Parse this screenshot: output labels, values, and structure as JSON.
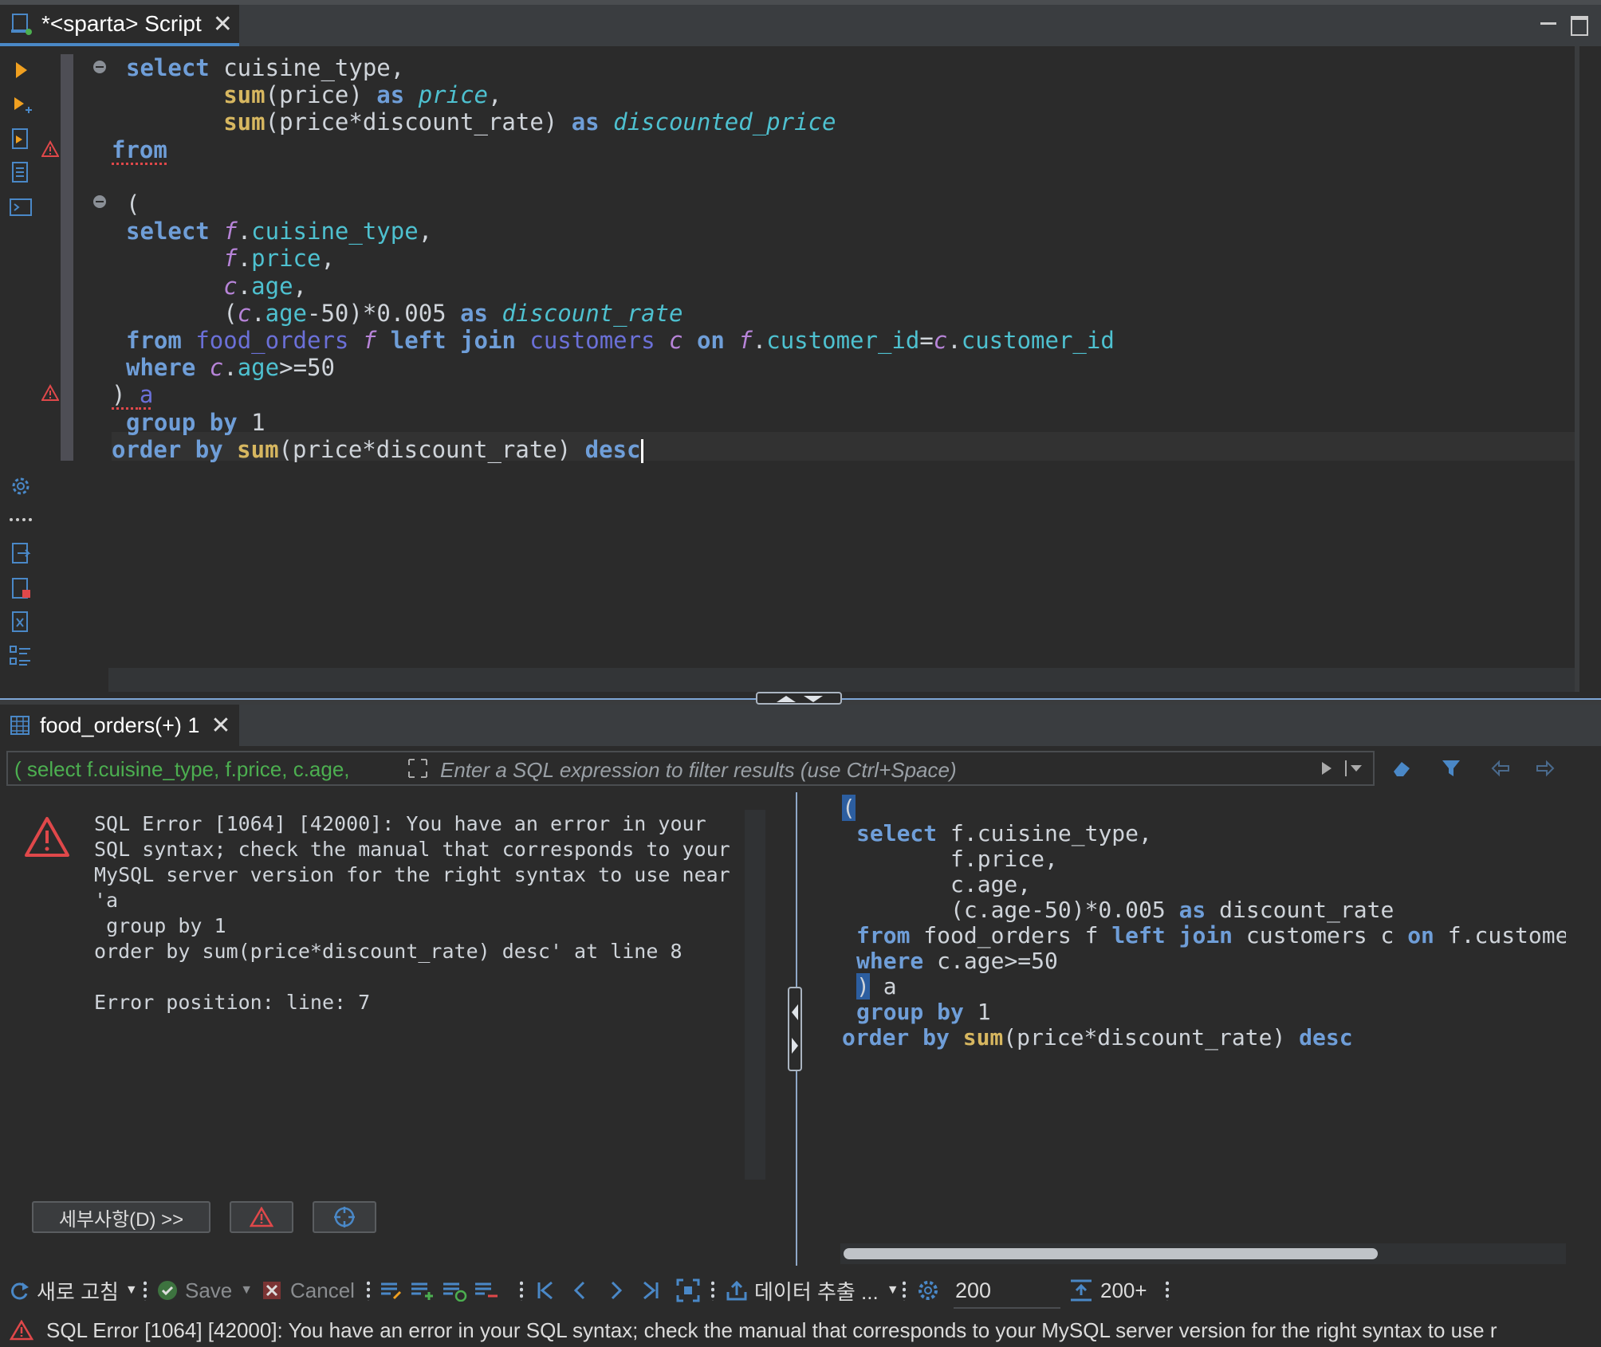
{
  "editor_tab": {
    "title": "*<sparta> Script"
  },
  "code_lines": [
    [
      {
        "t": "select",
        "c": "kw"
      },
      {
        "t": " cuisine_type,",
        "c": ""
      }
    ],
    [
      {
        "t": "       ",
        "c": ""
      },
      {
        "t": "sum",
        "c": "fn"
      },
      {
        "t": "(price) ",
        "c": ""
      },
      {
        "t": "as",
        "c": "kw"
      },
      {
        "t": " ",
        "c": ""
      },
      {
        "t": "price",
        "c": "al"
      },
      {
        "t": ",",
        "c": ""
      }
    ],
    [
      {
        "t": "       ",
        "c": ""
      },
      {
        "t": "sum",
        "c": "fn"
      },
      {
        "t": "(price*discount_rate) ",
        "c": ""
      },
      {
        "t": "as",
        "c": "kw"
      },
      {
        "t": " ",
        "c": ""
      },
      {
        "t": "discounted_price",
        "c": "al"
      }
    ],
    [
      {
        "t": "from",
        "c": "kw squig"
      }
    ],
    [],
    [
      {
        "t": "(",
        "c": ""
      }
    ],
    [
      {
        "t": "select",
        "c": "kw"
      },
      {
        "t": " ",
        "c": ""
      },
      {
        "t": "f",
        "c": "pi"
      },
      {
        "t": ".",
        "c": ""
      },
      {
        "t": "cuisine_type",
        "c": "id"
      },
      {
        "t": ",",
        "c": ""
      }
    ],
    [
      {
        "t": "       ",
        "c": ""
      },
      {
        "t": "f",
        "c": "pi"
      },
      {
        "t": ".",
        "c": ""
      },
      {
        "t": "price",
        "c": "id"
      },
      {
        "t": ",",
        "c": ""
      }
    ],
    [
      {
        "t": "       ",
        "c": ""
      },
      {
        "t": "c",
        "c": "pi"
      },
      {
        "t": ".",
        "c": ""
      },
      {
        "t": "age",
        "c": "id"
      },
      {
        "t": ",",
        "c": ""
      }
    ],
    [
      {
        "t": "       (",
        "c": ""
      },
      {
        "t": "c",
        "c": "pi"
      },
      {
        "t": ".",
        "c": ""
      },
      {
        "t": "age",
        "c": "id"
      },
      {
        "t": "-50)*0.005 ",
        "c": ""
      },
      {
        "t": "as",
        "c": "kw"
      },
      {
        "t": " ",
        "c": ""
      },
      {
        "t": "discount_rate",
        "c": "al"
      }
    ],
    [
      {
        "t": "from",
        "c": "kw"
      },
      {
        "t": " ",
        "c": ""
      },
      {
        "t": "food_orders",
        "c": "pu"
      },
      {
        "t": " ",
        "c": ""
      },
      {
        "t": "f",
        "c": "pi"
      },
      {
        "t": " ",
        "c": ""
      },
      {
        "t": "left join",
        "c": "kw"
      },
      {
        "t": " ",
        "c": ""
      },
      {
        "t": "customers",
        "c": "pu"
      },
      {
        "t": " ",
        "c": ""
      },
      {
        "t": "c",
        "c": "pi"
      },
      {
        "t": " ",
        "c": ""
      },
      {
        "t": "on",
        "c": "kw"
      },
      {
        "t": " ",
        "c": ""
      },
      {
        "t": "f",
        "c": "pi"
      },
      {
        "t": ".",
        "c": ""
      },
      {
        "t": "customer_id",
        "c": "id"
      },
      {
        "t": "=",
        "c": ""
      },
      {
        "t": "c",
        "c": "pi"
      },
      {
        "t": ".",
        "c": ""
      },
      {
        "t": "customer_id",
        "c": "id"
      }
    ],
    [
      {
        "t": "where",
        "c": "kw"
      },
      {
        "t": " ",
        "c": ""
      },
      {
        "t": "c",
        "c": "pi"
      },
      {
        "t": ".",
        "c": ""
      },
      {
        "t": "age",
        "c": "id"
      },
      {
        "t": ">=50",
        "c": ""
      }
    ],
    [
      {
        "t": ") ",
        "c": "squig"
      },
      {
        "t": "a",
        "c": "pu squig"
      }
    ],
    [
      {
        "t": "group by",
        "c": "kw"
      },
      {
        "t": " 1",
        "c": ""
      }
    ],
    [
      {
        "t": "order by",
        "c": "kw"
      },
      {
        "t": " ",
        "c": ""
      },
      {
        "t": "sum",
        "c": "fn"
      },
      {
        "t": "(price*discount_rate) ",
        "c": ""
      },
      {
        "t": "desc",
        "c": "kw"
      }
    ]
  ],
  "results_tab": {
    "title": "food_orders(+) 1"
  },
  "filter": {
    "query": "( select f.cuisine_type, f.price, c.age,",
    "placeholder": "Enter a SQL expression to filter results (use Ctrl+Space)"
  },
  "error": {
    "message": "SQL Error [1064] [42000]: You have an error in your SQL syntax; check the manual that corresponds to your MySQL server version for the right syntax to use near 'a\n group by 1\norder by sum(price*discount_rate) desc' at line 8\n\nError position: line: 7",
    "details_button": "세부사항(D) >>"
  },
  "query_preview": [
    [
      {
        "t": "(",
        "c": "sel-paren"
      }
    ],
    [
      {
        "t": "select",
        "c": "kw"
      },
      {
        "t": " f.cuisine_type,",
        "c": ""
      }
    ],
    [
      {
        "t": "       f.price,",
        "c": ""
      }
    ],
    [
      {
        "t": "       c.age,",
        "c": ""
      }
    ],
    [
      {
        "t": "       (c.age-50)*0.005 ",
        "c": ""
      },
      {
        "t": "as",
        "c": "kw"
      },
      {
        "t": " discount_rate",
        "c": ""
      }
    ],
    [
      {
        "t": "from",
        "c": "kw"
      },
      {
        "t": " food_orders f ",
        "c": ""
      },
      {
        "t": "left join",
        "c": "kw"
      },
      {
        "t": " customers c ",
        "c": ""
      },
      {
        "t": "on",
        "c": "kw"
      },
      {
        "t": " f.customer_id=c.customer_id",
        "c": ""
      }
    ],
    [
      {
        "t": "where",
        "c": "kw"
      },
      {
        "t": " c.age>=50",
        "c": ""
      }
    ],
    [
      {
        "t": ")",
        "c": "sel-paren"
      },
      {
        "t": " a",
        "c": ""
      }
    ],
    [
      {
        "t": "group by",
        "c": "kw"
      },
      {
        "t": " 1",
        "c": ""
      }
    ],
    [
      {
        "t": "order by",
        "c": "kw"
      },
      {
        "t": " ",
        "c": ""
      },
      {
        "t": "sum",
        "c": "fn"
      },
      {
        "t": "(price*discount_rate) ",
        "c": ""
      },
      {
        "t": "desc",
        "c": "kw"
      }
    ]
  ],
  "bottom_toolbar": {
    "refresh": "새로 고침",
    "save": "Save",
    "cancel": "Cancel",
    "export": "데이터 추출 ...",
    "fetch_size": "200",
    "fetch_count": "200+"
  },
  "status": {
    "message": "SQL Error [1064] [42000]: You have an error in your SQL syntax; check the manual that corresponds to your MySQL server version for the right syntax to use r"
  },
  "colors": {
    "keyword": "#6f9ed8",
    "function": "#d7b760",
    "alias": "#4ec1d0",
    "error": "#e0484a",
    "background": "#2b2b2b"
  }
}
